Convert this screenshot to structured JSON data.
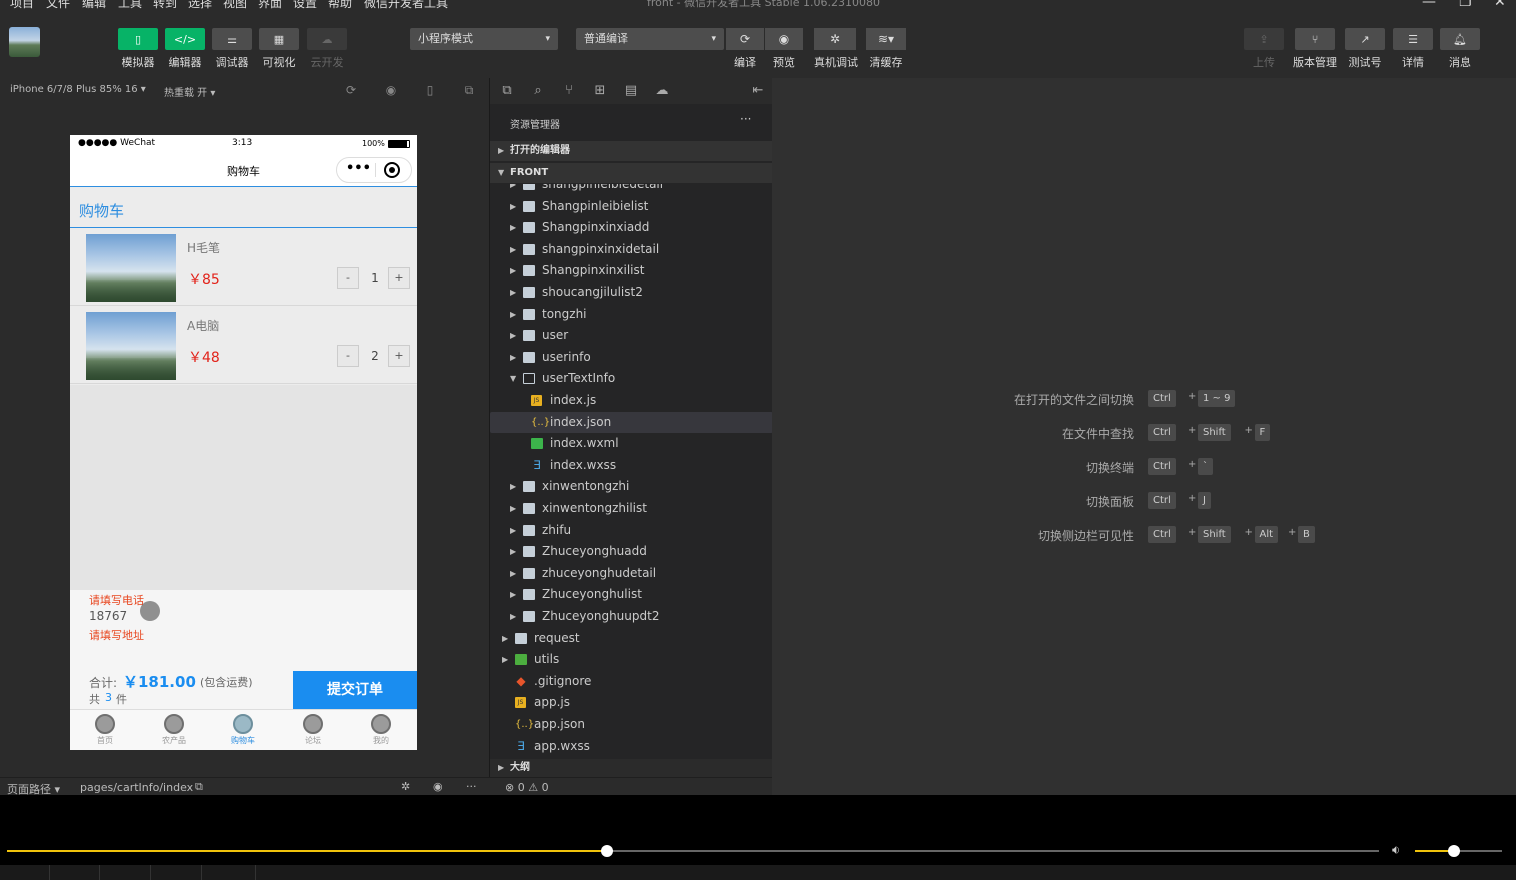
{
  "menu": {
    "items": [
      "项目",
      "文件",
      "编辑",
      "工具",
      "转到",
      "选择",
      "视图",
      "界面",
      "设置",
      "帮助",
      "微信开发者工具"
    ],
    "window_title": "front - 微信开发者工具 Stable 1.06.2310080"
  },
  "toolbar": {
    "left_buttons": [
      {
        "icon": "phone-icon",
        "label": "模拟器"
      },
      {
        "icon": "code-icon",
        "label": "编辑器"
      },
      {
        "icon": "debug-icon",
        "label": "调试器"
      },
      {
        "icon": "layout-icon",
        "label": "可视化"
      },
      {
        "icon": "cloud-icon",
        "label": "云开发"
      }
    ],
    "mode_select": "小程序模式",
    "compile_select": "普通编译",
    "center_buttons": [
      {
        "icon": "refresh-icon",
        "label": "编译"
      },
      {
        "icon": "eye-icon",
        "label": "预览"
      },
      {
        "icon": "bug-icon",
        "label": "真机调试"
      },
      {
        "icon": "layers-icon",
        "label": "清缓存"
      }
    ],
    "right_buttons": [
      {
        "icon": "upload-icon",
        "label": "上传"
      },
      {
        "icon": "branch-icon",
        "label": "版本管理"
      },
      {
        "icon": "share-icon",
        "label": "测试号"
      },
      {
        "icon": "menu-icon",
        "label": "详情"
      },
      {
        "icon": "bell-icon",
        "label": "消息"
      }
    ]
  },
  "simulator": {
    "device": "iPhone 6/7/8 Plus 85% 16 ▾",
    "hot_reload": "热重载 开 ▾",
    "status": {
      "carrier": "●●●●● WeChat",
      "time": "3:13",
      "battery": "100%"
    },
    "nav_title": "购物车",
    "page_header": "购物车",
    "items": [
      {
        "name": "H毛笔",
        "price": "￥85",
        "qty": "1"
      },
      {
        "name": "A电脑",
        "price": "￥48",
        "qty": "2"
      }
    ],
    "stepper_minus": "-",
    "stepper_plus": "+",
    "phone_error": "请填写电话",
    "phone_value": "18767",
    "address_error": "请填写地址",
    "total_label": "合计:",
    "total_value": "￥181.00",
    "total_note": "(包含运费)",
    "count_prefix": "共",
    "count_value": "3",
    "count_suffix": "件",
    "submit": "提交订单",
    "tabs": [
      "首页",
      "农产品",
      "购物车",
      "论坛",
      "我的"
    ],
    "active_tab": 2
  },
  "explorer": {
    "title": "资源管理器",
    "more": "···",
    "open_editors": "打开的编辑器",
    "project": "FRONT",
    "tree": [
      {
        "name": "shangpinleibiedetail",
        "type": "folder",
        "depth": 1
      },
      {
        "name": "Shangpinleibielist",
        "type": "folder",
        "depth": 1
      },
      {
        "name": "Shangpinxinxiadd",
        "type": "folder",
        "depth": 1
      },
      {
        "name": "shangpinxinxidetail",
        "type": "folder",
        "depth": 1
      },
      {
        "name": "Shangpinxinxilist",
        "type": "folder",
        "depth": 1
      },
      {
        "name": "shoucangjilulist2",
        "type": "folder",
        "depth": 1
      },
      {
        "name": "tongzhi",
        "type": "folder",
        "depth": 1
      },
      {
        "name": "user",
        "type": "folder",
        "depth": 1
      },
      {
        "name": "userinfo",
        "type": "folder",
        "depth": 1
      },
      {
        "name": "userTextInfo",
        "type": "folder-open",
        "depth": 1
      },
      {
        "name": "index.js",
        "type": "js",
        "depth": 2
      },
      {
        "name": "index.json",
        "type": "json",
        "depth": 2,
        "selected": true
      },
      {
        "name": "index.wxml",
        "type": "wxml",
        "depth": 2
      },
      {
        "name": "index.wxss",
        "type": "wxss",
        "depth": 2
      },
      {
        "name": "xinwentongzhi",
        "type": "folder",
        "depth": 1
      },
      {
        "name": "xinwentongzhilist",
        "type": "folder",
        "depth": 1
      },
      {
        "name": "zhifu",
        "type": "folder",
        "depth": 1
      },
      {
        "name": "Zhuceyonghuadd",
        "type": "folder",
        "depth": 1
      },
      {
        "name": "zhuceyonghudetail",
        "type": "folder",
        "depth": 1
      },
      {
        "name": "Zhuceyonghulist",
        "type": "folder",
        "depth": 1
      },
      {
        "name": "Zhuceyonghuupdt2",
        "type": "folder",
        "depth": 1
      },
      {
        "name": "request",
        "type": "folder",
        "depth": 0
      },
      {
        "name": "utils",
        "type": "utils",
        "depth": 0
      },
      {
        "name": ".gitignore",
        "type": "git",
        "depth": 0
      },
      {
        "name": "app.js",
        "type": "js",
        "depth": 0
      },
      {
        "name": "app.json",
        "type": "json",
        "depth": 0
      },
      {
        "name": "app.wxss",
        "type": "wxss",
        "depth": 0
      }
    ],
    "outline": "大纲"
  },
  "editor_hints": [
    {
      "label": "在打开的文件之间切换",
      "keys": [
        "Ctrl",
        "1 ~ 9"
      ]
    },
    {
      "label": "在文件中查找",
      "keys": [
        "Ctrl",
        "Shift",
        "F"
      ]
    },
    {
      "label": "切换终端",
      "keys": [
        "Ctrl",
        "`"
      ]
    },
    {
      "label": "切换面板",
      "keys": [
        "Ctrl",
        "J"
      ]
    },
    {
      "label": "切换侧边栏可见性",
      "keys": [
        "Ctrl",
        "Shift",
        "Alt",
        "B"
      ]
    }
  ],
  "statusbar": {
    "page_path_label": "页面路径 ▾",
    "page_path": "pages/cartInfo/index",
    "problems": "⊗ 0 ⚠ 0"
  },
  "player": {
    "progress": 0.437,
    "volume": 0.45
  },
  "colors": {
    "accent_green": "#07b367",
    "accent_blue": "#1a8df0",
    "price_red": "#e2231a",
    "progress_yellow": "#f0c30c"
  }
}
